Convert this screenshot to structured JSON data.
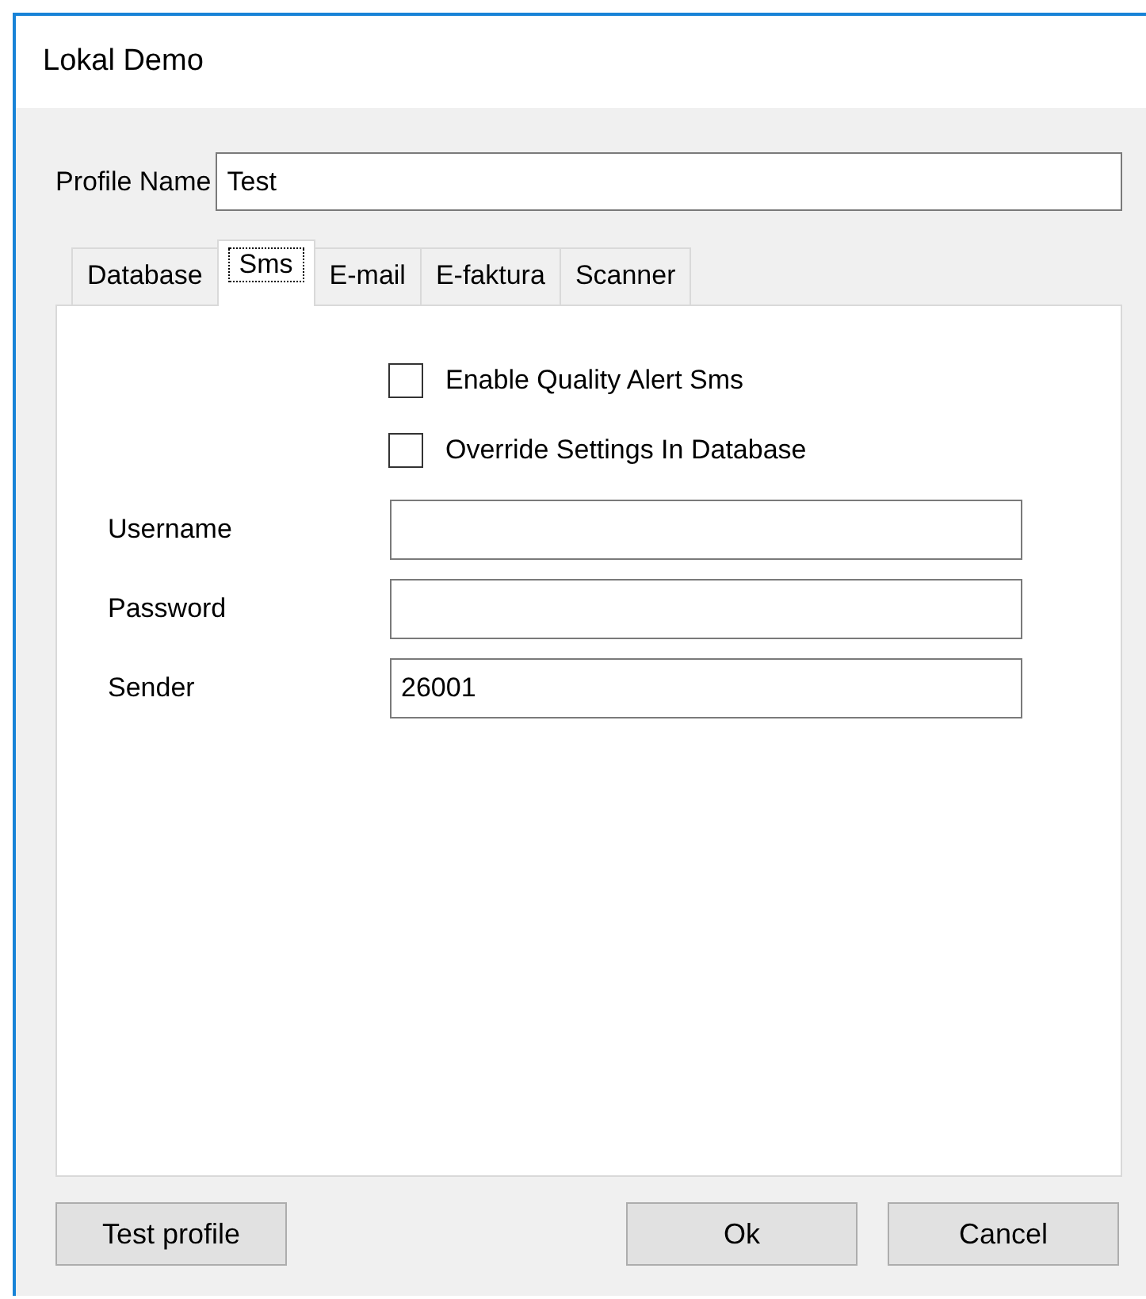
{
  "window": {
    "title": "Lokal Demo"
  },
  "profile_name": {
    "label": "Profile Name",
    "value": "Test"
  },
  "tabs": [
    {
      "label": "Database",
      "selected": false
    },
    {
      "label": "Sms",
      "selected": true
    },
    {
      "label": "E-mail",
      "selected": false
    },
    {
      "label": "E-faktura",
      "selected": false
    },
    {
      "label": "Scanner",
      "selected": false
    }
  ],
  "checkboxes": [
    {
      "label": "Enable Quality Alert Sms",
      "checked": false
    },
    {
      "label": "Override Settings In Database",
      "checked": false
    }
  ],
  "fields": [
    {
      "label": "Username"
    },
    {
      "label": "Password"
    },
    {
      "label": "Sender",
      "value": "26001"
    }
  ],
  "buttons": [
    {
      "label": "Test profile"
    },
    {
      "label": "Ok"
    },
    {
      "label": "Cancel"
    }
  ]
}
